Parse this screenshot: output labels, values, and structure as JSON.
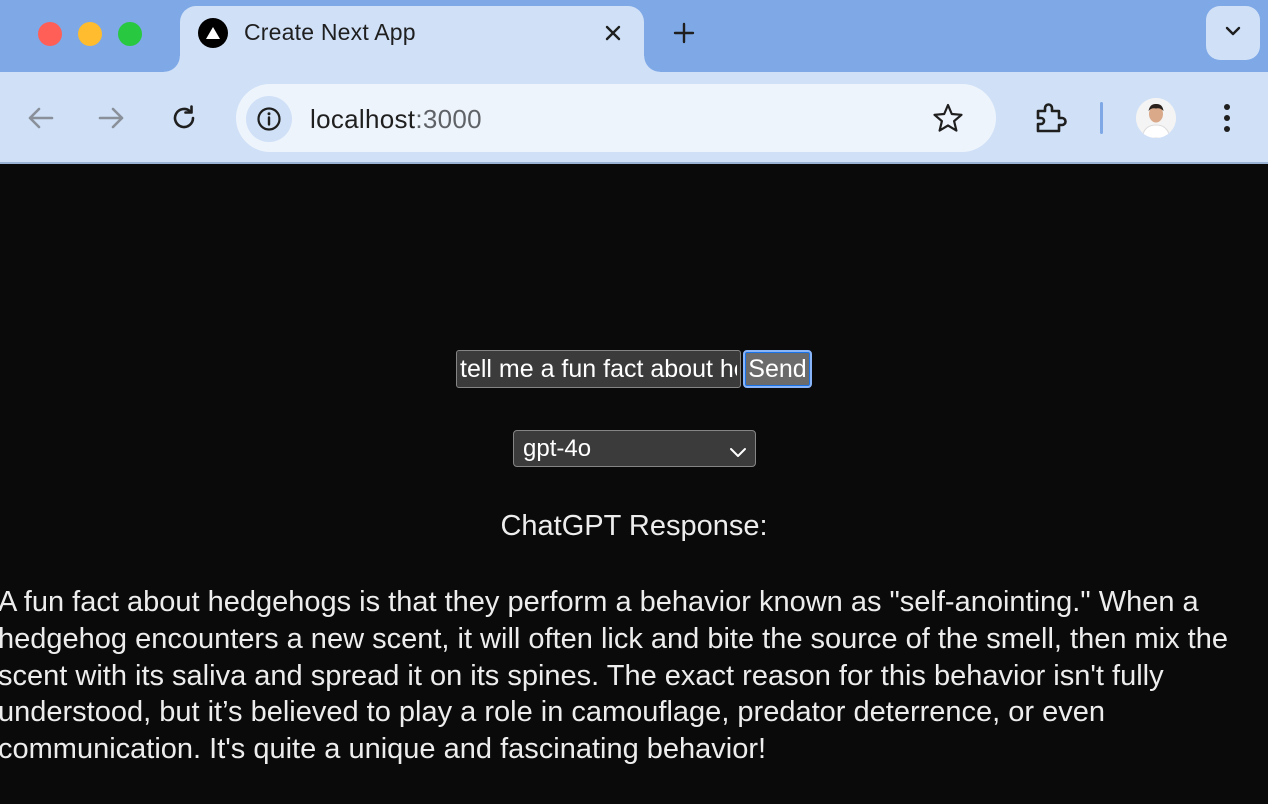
{
  "browser": {
    "tab": {
      "title": "Create Next App"
    },
    "address_bar": {
      "host": "localhost",
      "port": ":3000"
    }
  },
  "page": {
    "prompt": {
      "value": "tell me a fun fact about hedgehogs"
    },
    "send_label": "Send",
    "model": {
      "selected": "gpt-4o"
    },
    "response_heading": "ChatGPT Response:",
    "response_text": "A fun fact about hedgehogs is that they perform a behavior known as \"self-anointing.\" When a hedgehog encounters a new scent, it will often lick and bite the source of the smell, then mix the scent with its saliva and spread it on its spines. The exact reason for this behavior isn't fully understood, but it’s believed to play a role in camouflage, predator deterrence, or even communication. It's quite a unique and fascinating behavior!"
  },
  "icons": [
    "nextjs-favicon-icon",
    "close-icon",
    "plus-icon",
    "chevron-down-icon",
    "back-arrow-icon",
    "forward-arrow-icon",
    "reload-icon",
    "info-icon",
    "star-icon",
    "puzzle-icon",
    "kebab-menu-icon"
  ],
  "colors": {
    "tabstrip": "#7ea8e6",
    "toolbar": "#cfe0f7",
    "page_background": "#0a0a0a",
    "focus_ring": "#8ab4f8"
  }
}
